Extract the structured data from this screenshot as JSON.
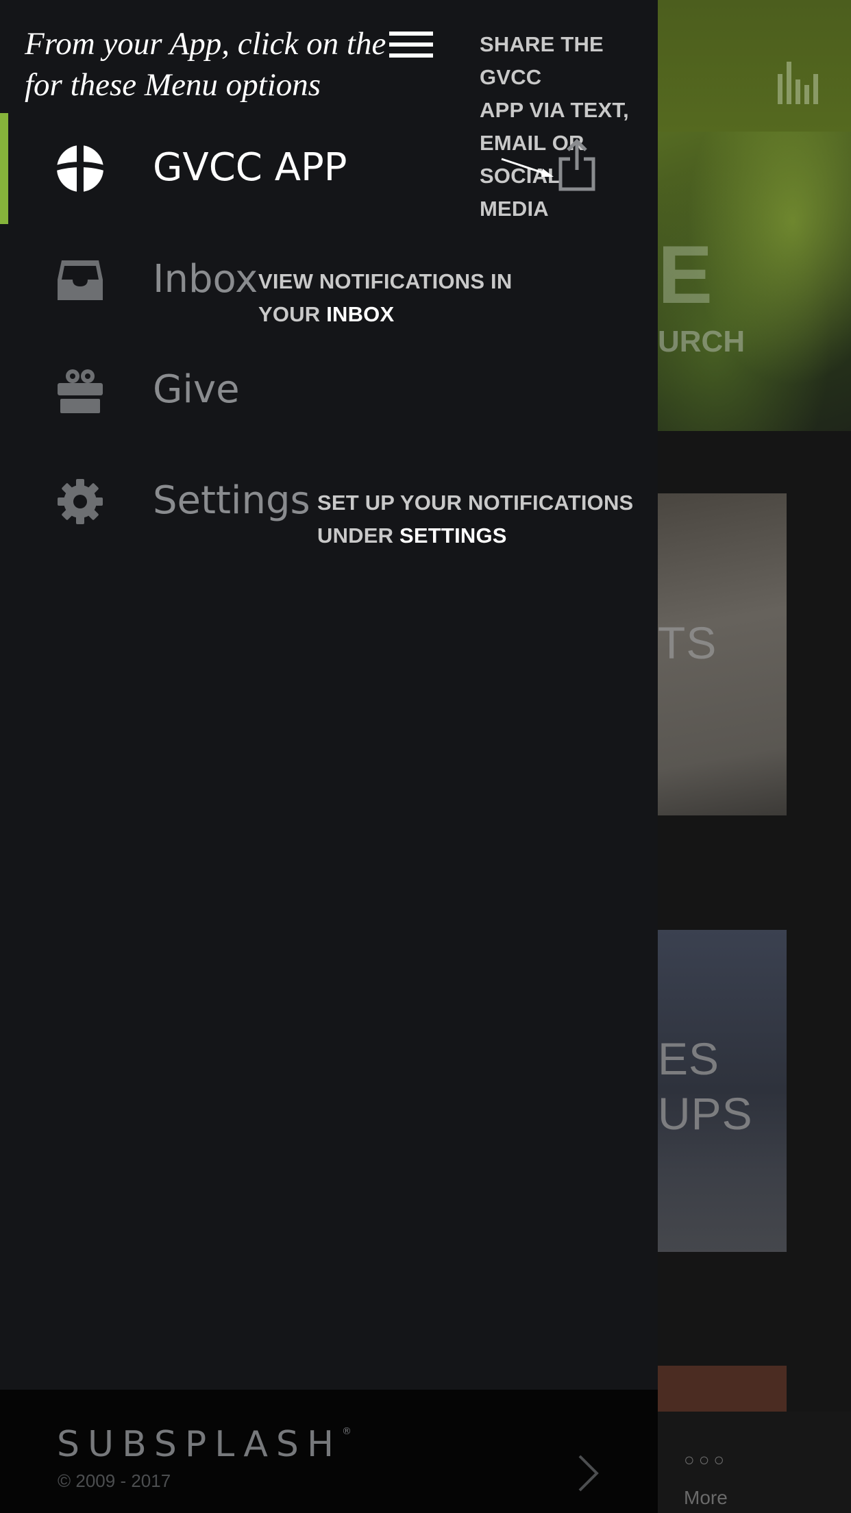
{
  "tip": {
    "line1": "From your App, click on the",
    "line2": "for these Menu options"
  },
  "callouts": {
    "share": "SHARE THE GVCC\nAPP VIA TEXT,\nEMAIL OR SOCIAL\nMEDIA",
    "inbox_prefix": "VIEW NOTIFICATIONS IN\nYOUR ",
    "inbox_emphasis": "INBOX",
    "settings_prefix": "SET UP YOUR NOTIFICATIONS\nUNDER ",
    "settings_emphasis": "SETTINGS"
  },
  "menu": {
    "items": [
      {
        "label": "GVCC APP",
        "icon": "church-logo-icon",
        "active": true
      },
      {
        "label": "Inbox",
        "icon": "inbox-tray-icon",
        "active": false
      },
      {
        "label": "Give",
        "icon": "gift-icon",
        "active": false
      },
      {
        "label": "Settings",
        "icon": "gear-icon",
        "active": false
      }
    ]
  },
  "footer": {
    "brand": "SUBSPLASH",
    "registered": "®",
    "copyright": "© 2009 - 2017"
  },
  "background_app": {
    "hero_big": "E",
    "hero_sub": "URCH",
    "card_events": "TS",
    "card_groups_line1": "ES",
    "card_groups_line2": "UPS",
    "more_dots": "○○○",
    "more_label": "More"
  },
  "colors": {
    "drawer_bg": "#141518",
    "active_accent": "#86b43b",
    "header_green": "#55691f",
    "footer_bg": "#050505"
  }
}
